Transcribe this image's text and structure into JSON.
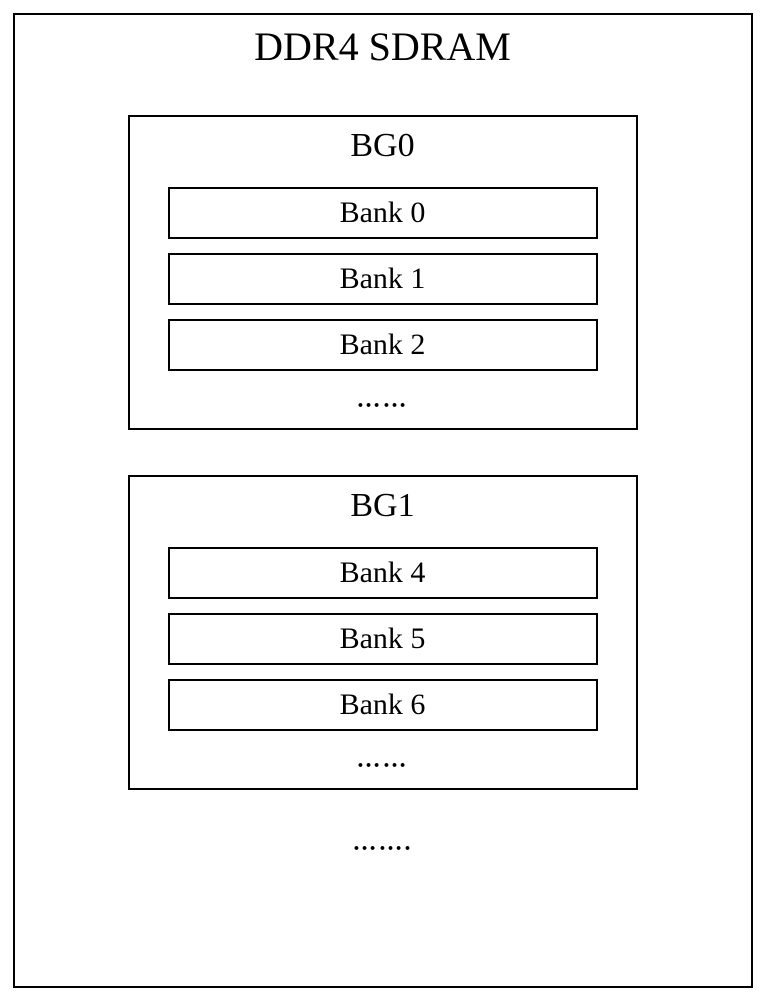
{
  "title": "DDR4 SDRAM",
  "groups": [
    {
      "name": "BG0",
      "banks": [
        "Bank 0",
        "Bank 1",
        "Bank 2"
      ],
      "ellipsis": "……"
    },
    {
      "name": "BG1",
      "banks": [
        "Bank 4",
        "Bank 5",
        "Bank 6"
      ],
      "ellipsis": "……"
    }
  ],
  "bottom_ellipsis": "……."
}
